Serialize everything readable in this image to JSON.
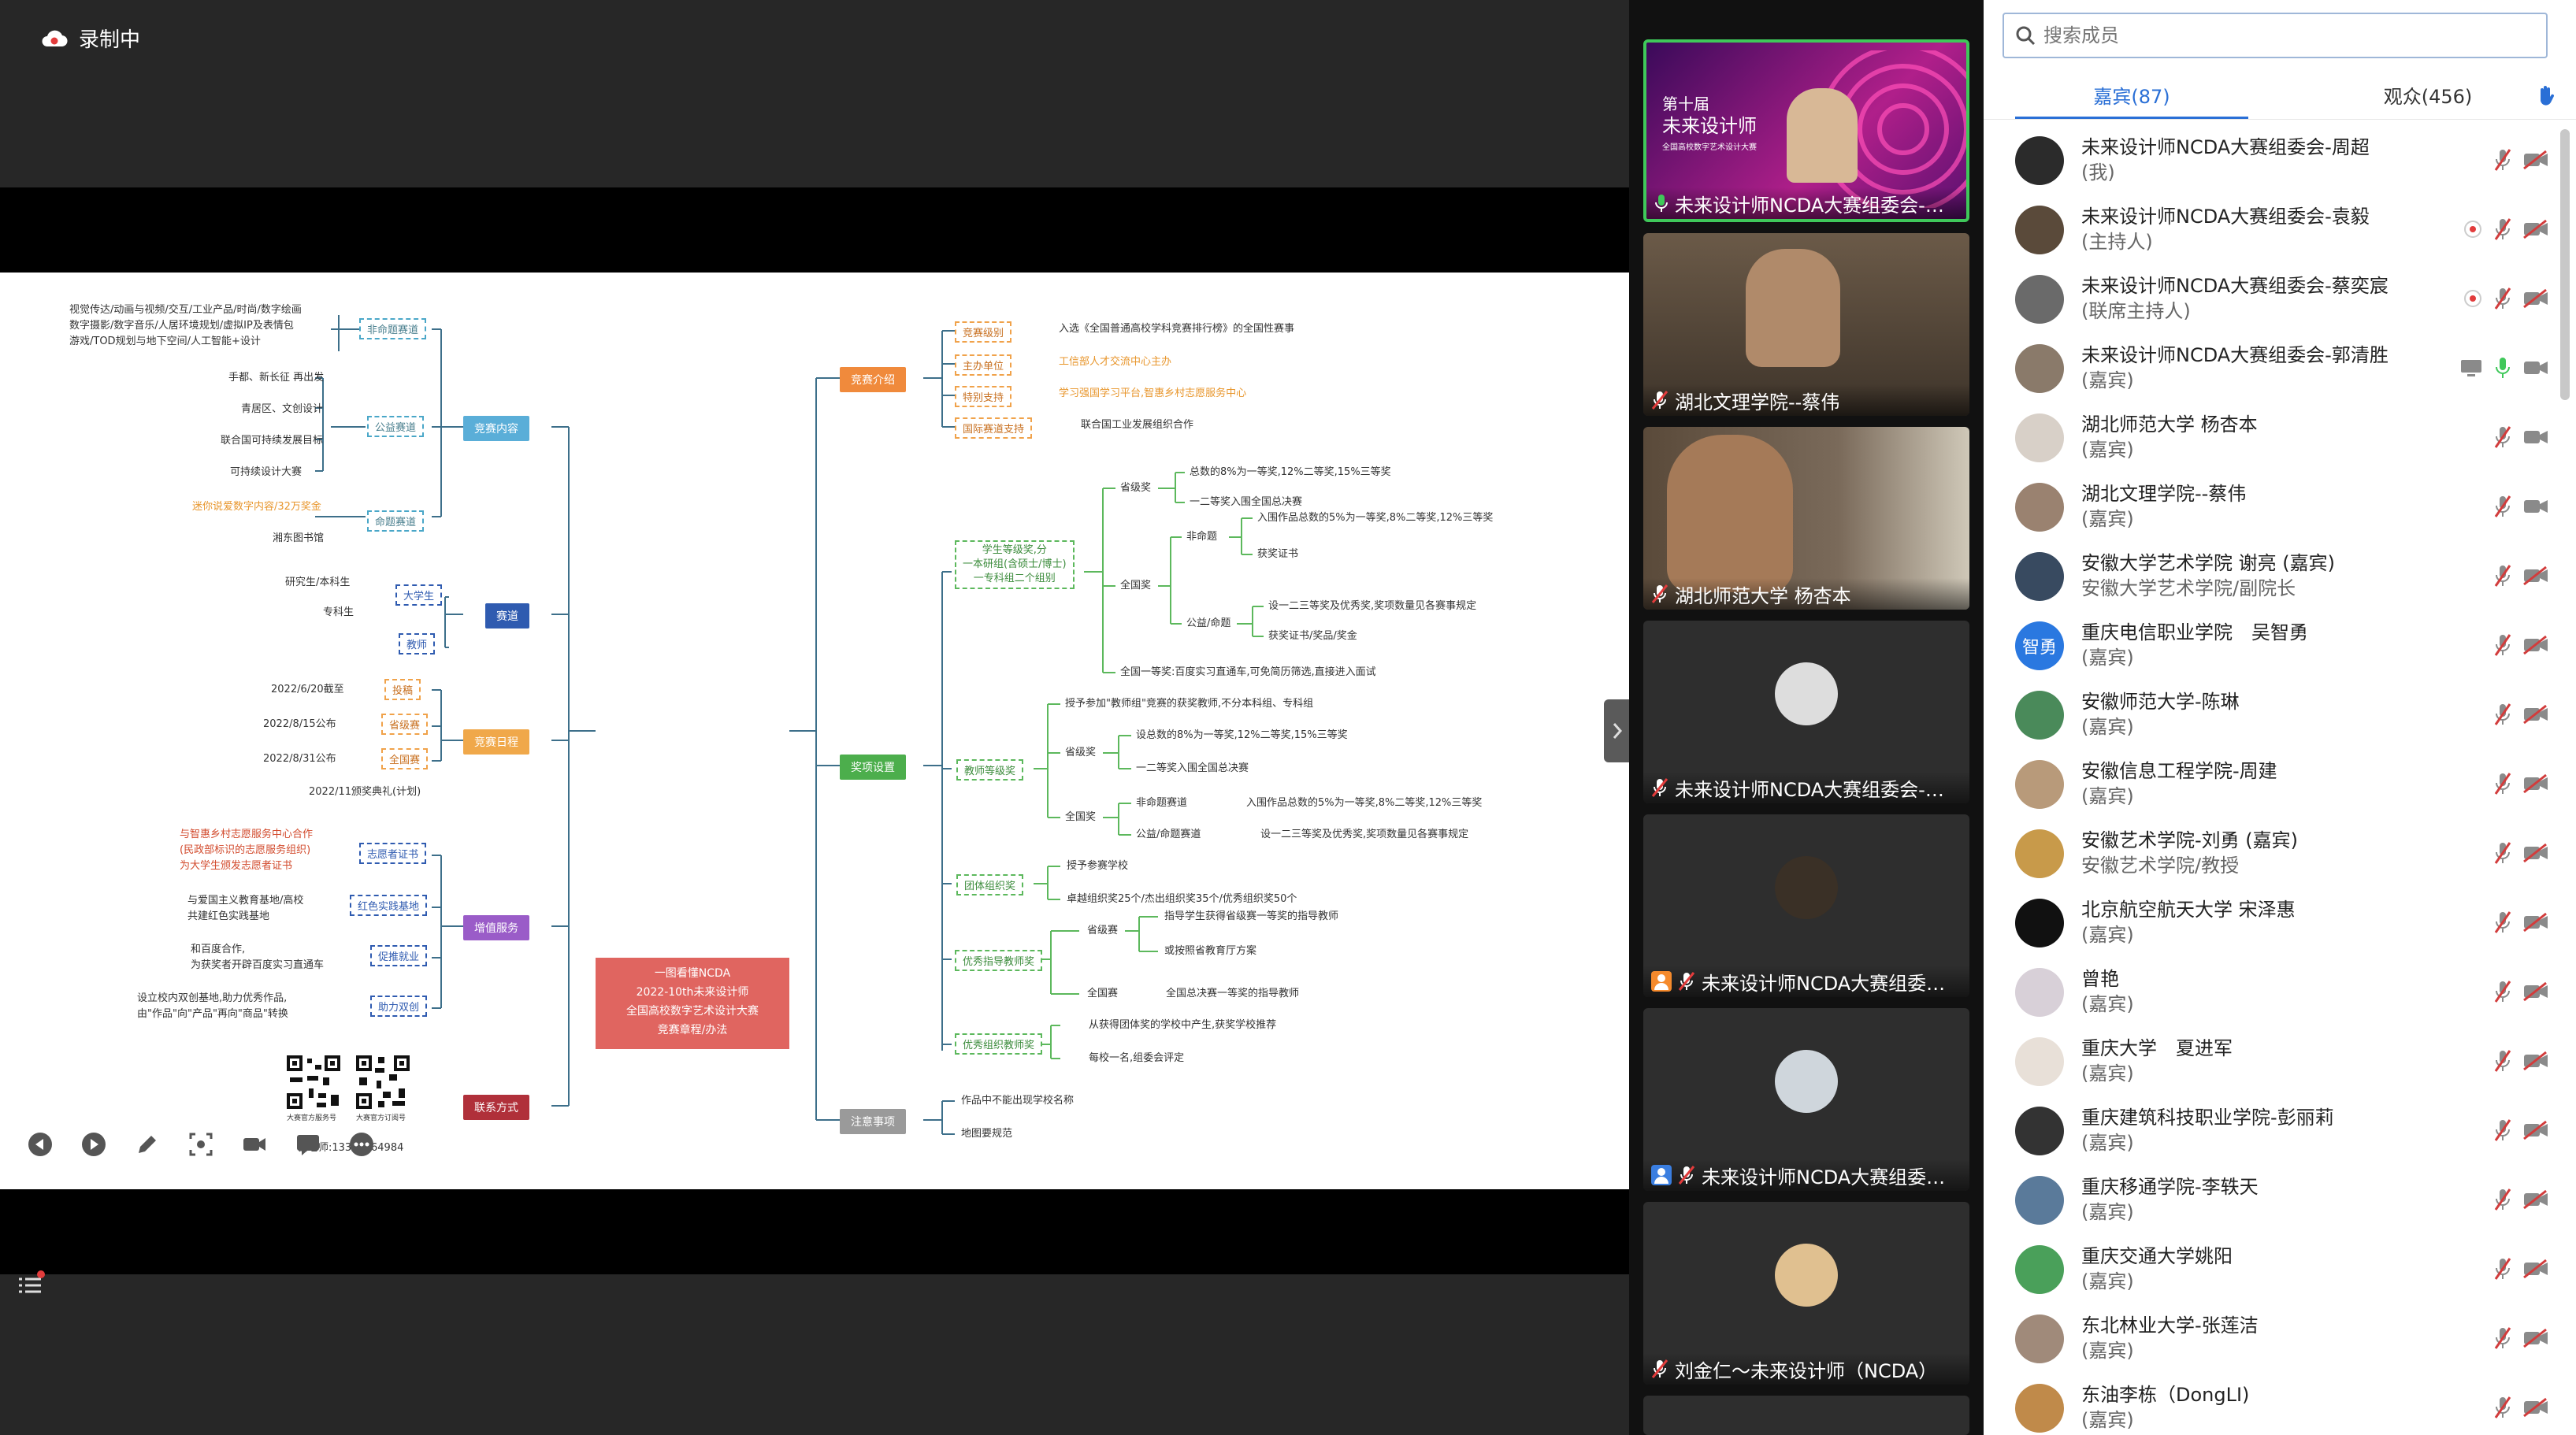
{
  "recording": {
    "label": "录制中"
  },
  "mindmap": {
    "center": [
      "一图看懂NCDA",
      "2022-10th未来设计师",
      "全国高校数字艺术设计大赛",
      "竞赛章程/办法"
    ],
    "left_branches": [
      "竞赛内容",
      "赛道",
      "竞赛日程",
      "增值服务",
      "联系方式"
    ],
    "right_branches": [
      "竞赛介绍",
      "奖项设置",
      "注意事项"
    ],
    "content_texts": [
      "视觉传达/动画与视频/交互/工业产品/时尚/数字绘画",
      "数字摄影/数字音乐/人居环境规划/虚拟IP及表情包",
      "游戏/TOD规划与地下空间/人工智能+设计",
      "非命题赛道",
      "手都、新长征 再出发",
      "青居区、文创设计",
      "联合国可持续发展目标",
      "可持续设计大赛",
      "公益赛道",
      "迷你说爱数字内容/32万奖金",
      "湘东图书馆",
      "命题赛道"
    ],
    "track_texts": [
      "研究生/本科生",
      "大学生",
      "专科生",
      "教师"
    ],
    "schedule_texts": [
      "2022/6/20截至",
      "投稿",
      "2022/8/15公布",
      "省级赛",
      "2022/8/31公布",
      "全国赛",
      "2022/11颁奖典礼(计划)"
    ],
    "service_texts": [
      "与智惠乡村志愿服务中心合作",
      "(民政部标识的志愿服务组织)",
      "为大学生颁发志愿者证书",
      "志愿者证书",
      "与爱国主义教育基地/高校",
      "共建红色实践基地",
      "红色实践基地",
      "和百度合作,",
      "为获奖者开辟百度实习直通车",
      "促推就业",
      "设立校内双创基地,助力优秀作品,",
      "由\"作品\"向\"产品\"再向\"商品\"转换",
      "助力双创"
    ],
    "contact_texts": [
      "大赛官方服务号",
      "大赛官方订阅号",
      "吕老师:13317564984"
    ],
    "intro_texts": [
      "竞赛级别",
      "入选《全国普通高校学科竞赛排行榜》的全国性赛事",
      "主办单位",
      "工信部人才交流中心主办",
      "特别支持",
      "学习强国学习平台,智惠乡村志愿服务中心",
      "国际赛道支持",
      "联合国工业发展组织合作"
    ],
    "award_texts": [
      "学生等级奖,分",
      "一本研组(含硕士/博士)",
      "一专科组二个组别",
      "省级奖",
      "总数的8%为一等奖,12%二等奖,15%三等奖",
      "一二等奖入围全国总决赛",
      "全国奖",
      "非命题",
      "入围作品总数的5%为一等奖,8%二等奖,12%三等奖",
      "获奖证书",
      "公益/命题",
      "设一二三等奖及优秀奖,奖项数量见各赛事规定",
      "获奖证书/奖品/奖金",
      "全国一等奖:百度实习直通车,可免简历筛选,直接进入面试",
      "教师等级奖",
      "授予参加\"教师组\"竞赛的获奖教师,不分本科组、专科组",
      "省级奖",
      "设总数的8%为一等奖,12%二等奖,15%三等奖",
      "一二等奖入围全国总决赛",
      "全国奖",
      "非命题赛道",
      "入围作品总数的5%为一等奖,8%二等奖,12%三等奖",
      "公益/命题赛道",
      "设一二三等奖及优秀奖,奖项数量见各赛事规定",
      "团体组织奖",
      "授予参赛学校",
      "卓越组织奖25个/杰出组织奖35个/优秀组织奖50个",
      "优秀指导教师奖",
      "省级赛",
      "指导学生获得省级赛一等奖的指导教师",
      "或按照省教育厅方案",
      "全国赛",
      "全国总决赛一等奖的指导教师",
      "优秀组织教师奖",
      "从获得团体奖的学校中产生,获奖学校推荐",
      "每校一名,组委会评定"
    ],
    "notes_texts": [
      "作品中不能出现学校名称",
      "地图要规范"
    ]
  },
  "video_tiles": [
    {
      "name": "未来设计师NCDA大赛组委会-…",
      "poster": [
        "第十届",
        "未来设计师",
        "全国高校数字艺术设计大赛"
      ]
    },
    {
      "name": "湖北文理学院--蔡伟"
    },
    {
      "name": "湖北师范大学 杨杏本"
    },
    {
      "name": "未来设计师NCDA大赛组委会-…"
    },
    {
      "name": "未来设计师NCDA大赛组委…"
    },
    {
      "name": "未来设计师NCDA大赛组委…"
    },
    {
      "name": "刘金仁～未来设计师（NCDA）"
    }
  ],
  "panel": {
    "search_placeholder": "搜索成员",
    "tabs": [
      "嘉宾(87)",
      "观众(456)"
    ],
    "participants": [
      {
        "name": "未来设计师NCDA大赛组委会-周超",
        "sub": "(我)"
      },
      {
        "name": "未来设计师NCDA大赛组委会-袁毅",
        "sub": "(主持人)"
      },
      {
        "name": "未来设计师NCDA大赛组委会-蔡奕宸",
        "sub": "(联席主持人)"
      },
      {
        "name": "未来设计师NCDA大赛组委会-郭清胜",
        "sub": "(嘉宾)"
      },
      {
        "name": "湖北师范大学 杨杏本",
        "sub": "(嘉宾)"
      },
      {
        "name": "湖北文理学院--蔡伟",
        "sub": "(嘉宾)"
      },
      {
        "name": "安徽大学艺术学院 谢亮 (嘉宾)",
        "sub": "安徽大学艺术学院/副院长"
      },
      {
        "name": "重庆电信职业学院　吴智勇",
        "sub": "(嘉宾)",
        "avatar_text": "智勇"
      },
      {
        "name": "安徽师范大学-陈琳",
        "sub": "(嘉宾)"
      },
      {
        "name": "安徽信息工程学院-周建",
        "sub": "(嘉宾)"
      },
      {
        "name": "安徽艺术学院-刘勇 (嘉宾)",
        "sub": "安徽艺术学院/教授"
      },
      {
        "name": "北京航空航天大学 宋泽惠",
        "sub": "(嘉宾)"
      },
      {
        "name": "曾艳",
        "sub": "(嘉宾)"
      },
      {
        "name": "重庆大学　夏进军",
        "sub": "(嘉宾)"
      },
      {
        "name": "重庆建筑科技职业学院-彭丽莉",
        "sub": "(嘉宾)"
      },
      {
        "name": "重庆移通学院-李轶天",
        "sub": "(嘉宾)"
      },
      {
        "name": "重庆交通大学姚阳",
        "sub": "(嘉宾)"
      },
      {
        "name": "东北林业大学-张莲洁",
        "sub": "(嘉宾)"
      },
      {
        "name": "东油李栋（DongLI)",
        "sub": "(嘉宾)"
      }
    ]
  },
  "colors": {
    "accent": "#2a6fd6",
    "active_speaker": "#3fc85a",
    "mute_red": "#d23c3c"
  }
}
